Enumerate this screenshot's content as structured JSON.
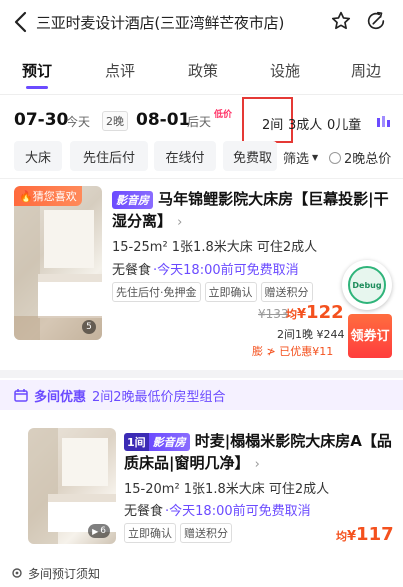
{
  "header": {
    "title": "三亚时麦设计酒店(三亚湾鲜芒夜市店)",
    "icons": [
      "back-icon",
      "star-icon",
      "share-icon"
    ]
  },
  "tabs": [
    {
      "label": "预订",
      "active": true
    },
    {
      "label": "点评"
    },
    {
      "label": "政策"
    },
    {
      "label": "设施"
    },
    {
      "label": "周边"
    }
  ],
  "datebar": {
    "checkin_date": "07-30",
    "checkin_hint": "今天",
    "nights": "2晚",
    "checkout_date": "08-01",
    "checkout_hint": "后天",
    "low_price_tag": "低价",
    "rooms": "2间",
    "adults": "3成人",
    "children": "0儿童"
  },
  "filters": {
    "chips": [
      "大床",
      "先住后付",
      "在线付",
      "免费取"
    ],
    "filter_label": "筛选",
    "total_price_label": "2晚总价"
  },
  "card1": {
    "guess_badge": "猜您喜欢",
    "photo_count": "5",
    "type_badge": "影音房",
    "title": "马年锦鲤影院大床房【巨幕投影|干湿分离】",
    "specs": "15-25m²  1张1.8米大床  可住2成人",
    "meal": "无餐食",
    "cancel": "今天18:00前可免费取消",
    "tags": [
      "先住后付·免押金",
      "立即确认",
      "赠送积分"
    ],
    "original_price": "¥133",
    "member_label": "均",
    "price_symbol": "¥",
    "price": "122",
    "total": "2间1晚 ¥244",
    "discount": "膨 ≯ 已优惠¥11",
    "book_label": "领券订",
    "debug_label": "Debug"
  },
  "multi_room": {
    "title": "多间优惠",
    "desc": "2间2晚最低价房型组合"
  },
  "card2": {
    "count_badge": "1间",
    "type_badge": "影音房",
    "title": "时麦|榻榻米影院大床房A【品质床品|窗明几净】",
    "photo_count": "6",
    "specs": "15-20m²  1张1.8米大床  可住2成人",
    "meal": "无餐食",
    "cancel": "今天18:00前可免费取消",
    "tags": [
      "立即确认",
      "赠送积分"
    ],
    "price_prefix": "均",
    "price_symbol": "¥",
    "price": "117"
  },
  "footer": {
    "notice": "多间预订须知"
  },
  "colors": {
    "accent": "#6b4bff",
    "price": "#f4511e",
    "highlight_box": "#e53935"
  }
}
